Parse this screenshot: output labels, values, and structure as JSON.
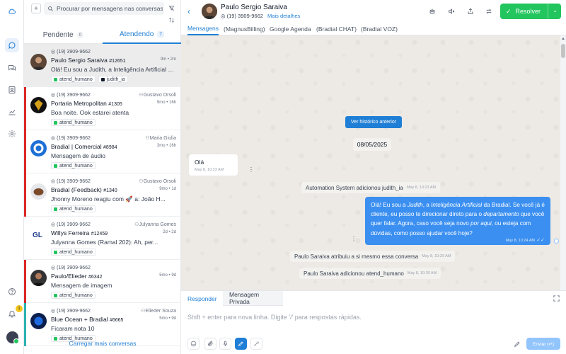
{
  "search": {
    "placeholder": "Procurar por mensagens nas conversas"
  },
  "list_tabs": [
    {
      "label": "Pendente",
      "count": "0"
    },
    {
      "label": "Atendendo",
      "count": "7"
    }
  ],
  "conversations": [
    {
      "phone": "(19) 3909-9662",
      "agent": "",
      "name": "Paulo Sergio Saraiva",
      "id": "#12651",
      "time": "9m • 2m",
      "message": "Olá! Eu sou a Judith, a Inteligência Artificial da Bradial",
      "tags": [
        "atend_humano",
        "judith_ia"
      ],
      "bar_color": "",
      "selected": true
    },
    {
      "phone": "(19) 3909-9662",
      "agent": "Gustavo Orsoli",
      "name": "Portaria Metropolitan",
      "id": "#1305",
      "time": "9mo • 16h",
      "message": "Boa noite. Ook estarei atenta",
      "tags": [
        "atend_humano"
      ],
      "bar_color": "#dc2626"
    },
    {
      "phone": "(19) 3909-9662",
      "agent": "Maria Giulia",
      "name": "Bradial | Comercial",
      "id": "#8984",
      "time": "3mo • 16h",
      "message": "Mensagem de áudio",
      "tags": [
        "atend_humano"
      ],
      "bar_color": "#dc2626"
    },
    {
      "phone": "(19) 3909-9662",
      "agent": "Gustavo Orsoli",
      "name": "Bradial (Feedback)",
      "id": "#1340",
      "time": "9mo • 1d",
      "message": "Jhonny Moreno reagiu com 🚀 a: João H...",
      "tags": [
        "atend_humano"
      ],
      "bar_color": "#dc2626"
    },
    {
      "phone": "(19) 3909-9662",
      "agent": "Julyanna Gomes",
      "name": "Willys Ferreira",
      "id": "#12459",
      "time": "2d • 2d",
      "message": "Julyanna Gomes (Ramal 202): Ah, per...",
      "tags": [
        "atend_humano"
      ],
      "bar_color": ""
    },
    {
      "phone": "(19) 3909-9662",
      "agent": "",
      "name": "Paulo/Elieder",
      "id": "#6342",
      "time": "5mo • 9d",
      "message": "Mensagem de imagem",
      "tags": [
        "atend_humano"
      ],
      "bar_color": "#dc2626"
    },
    {
      "phone": "(19) 3909-9662",
      "agent": "Elieder Souza",
      "name": "Blue Ocean + Bradial",
      "id": "#6665",
      "time": "5mo • 9d",
      "message": "Ficaram nota 10",
      "tags": [
        "atend_humano"
      ],
      "bar_color": "#2bb3b1"
    }
  ],
  "load_more": "Carregar mais conversas",
  "header": {
    "name": "Paulo Sergio Saraiva",
    "phone": "(19) 3909-9662",
    "more_details": "Mais detalhes",
    "resolve_label": "Resolver"
  },
  "sub_tabs": [
    "Mensagens",
    "(MagnusBilling)",
    "Google Agenda",
    "(Bradial CHAT)",
    "(Bradial VOZ)"
  ],
  "chat": {
    "history_button": "Ver histórico anterior",
    "date": "08/05/2025",
    "incoming": {
      "text": "Olá",
      "time": "May 8, 10:23 AM"
    },
    "system1": {
      "text": "Automation System adicionou judith_ia",
      "time": "May 8, 10:23 AM"
    },
    "outgoing": {
      "p1": "Olá! Eu sou a ",
      "p2": "Judith",
      "p3": ", a ",
      "p4": "Inteligência Artificial",
      "p5": " da Bradial. Se você já é cliente, eu posso te direcionar direto para o ",
      "p6": "departamento",
      "p7": " que você quer falar. Agora, caso você seja novo ",
      "p8": "por aqui",
      "p9": ", ou esteja com dúvidas, como posso ajudar você hoje?",
      "time": "May 8, 10:24 AM"
    },
    "system2": {
      "text": "Paulo Saraiva atribuiu a si mesmo essa conversa",
      "time": "May 8, 10:29 AM"
    },
    "system3": {
      "text": "Paulo Saraiva adicionou atend_humano",
      "time": "May 8, 10:30 AM"
    }
  },
  "composer": {
    "tab_reply": "Responder",
    "tab_private": "Mensagem Privada",
    "placeholder": "Shift + enter para nova linha. Digite '/' para respostas rápidas.",
    "send_label": "Enviar (↵)"
  },
  "notifications_count": "1",
  "colors": {
    "accent": "#1f7fd6",
    "resolve": "#22c55e",
    "outgoing": "#3b8ff0",
    "chat_bg": "#ede9e4"
  }
}
